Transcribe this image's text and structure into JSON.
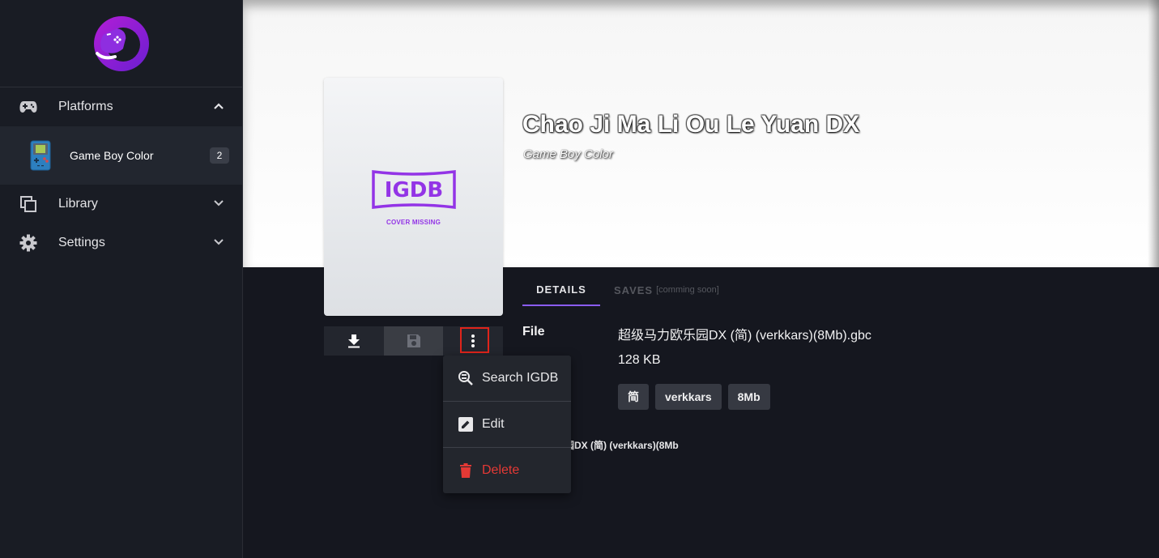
{
  "sidebar": {
    "logo_icon": "romm-logo-icon",
    "platforms_label": "Platforms",
    "platform_items": [
      {
        "label": "Game Boy Color",
        "count": "2",
        "icon": "game-boy-color-icon"
      }
    ],
    "library_label": "Library",
    "settings_label": "Settings"
  },
  "game": {
    "title": "Chao Ji Ma Li Ou Le Yuan DX",
    "platform": "Game Boy Color",
    "cover_logo_text": "IGDB",
    "cover_missing_text": "COVER MISSING"
  },
  "actions": {
    "download_icon": "download-icon",
    "save_icon": "floppy-disk-icon",
    "more_icon": "more-vertical-icon"
  },
  "context_menu": {
    "items": [
      {
        "label": "Search IGDB",
        "icon": "search-database-icon"
      },
      {
        "label": "Edit",
        "icon": "edit-pencil-icon"
      },
      {
        "label": "Delete",
        "icon": "trash-icon"
      }
    ]
  },
  "tabs": {
    "details": "DETAILS",
    "saves": "SAVES",
    "saves_note": "[comming soon]"
  },
  "details": {
    "file_label": "File",
    "file_name": "超级马力欧乐园DX (简) (verkkars)(8Mb).gbc",
    "file_size": "128 KB",
    "tags": [
      "简",
      "verkkars",
      "8Mb"
    ],
    "name_peek": "乐园DX (简) (verkkars)(8Mb"
  },
  "colors": {
    "accent": "#8b5cf6",
    "igdb_purple": "#9334e6",
    "delete_red": "#e53935",
    "highlight_red": "#e0241b"
  }
}
